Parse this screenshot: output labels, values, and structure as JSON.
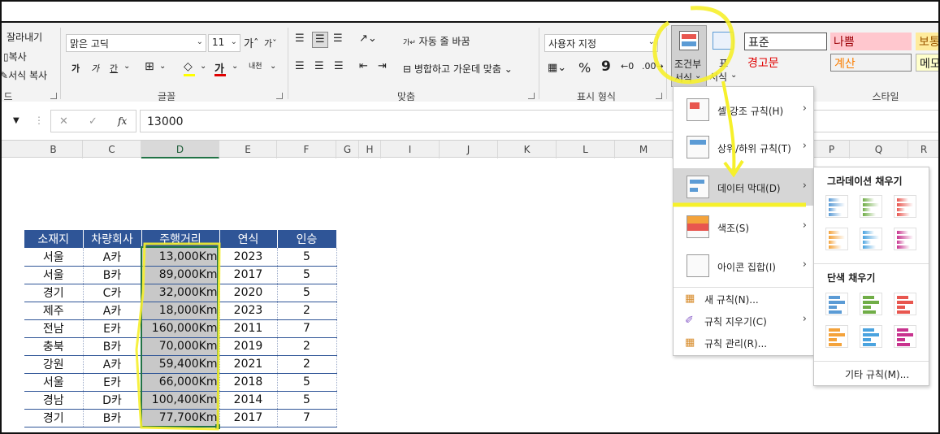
{
  "clipboard": {
    "cut": "잘라내기",
    "copy": "복사",
    "format_painter": "서식 복사",
    "label": "드"
  },
  "font": {
    "name": "맑은 고딕",
    "size": "11",
    "grow": "가",
    "shrink": "가",
    "bold": "가",
    "italic": "가",
    "underline": "간",
    "font_color_letter": "가",
    "phonetic": "내천",
    "label": "글꼴"
  },
  "alignment": {
    "wrap": "자동 줄 바꿈",
    "merge": "병합하고 가운데 맞춤",
    "label": "맞춤"
  },
  "number": {
    "format": "사용자 지정",
    "percent": "%",
    "comma": "9",
    "label": "표시 형식"
  },
  "styles": {
    "conditional_line1": "조건부",
    "conditional_line2": "서식",
    "table_line1": "표",
    "table_line2": "서식",
    "normal": "표준",
    "bad": "나쁨",
    "good": "보통",
    "warning": "경고문",
    "calc": "계산",
    "memo": "메모",
    "label": "스타일"
  },
  "formula": {
    "value": "13000",
    "fx": "fx",
    "cancel": "✕",
    "enter": "✓"
  },
  "columns": [
    "B",
    "C",
    "D",
    "E",
    "F",
    "G",
    "H",
    "I",
    "J",
    "K",
    "L",
    "M",
    "P",
    "Q",
    "R"
  ],
  "table": {
    "headers": [
      "소재지",
      "차량회사",
      "주행거리",
      "연식",
      "인승"
    ],
    "rows": [
      [
        "서울",
        "A카",
        "13,000Km",
        "2023",
        "5"
      ],
      [
        "서울",
        "B카",
        "89,000Km",
        "2017",
        "5"
      ],
      [
        "경기",
        "C카",
        "32,000Km",
        "2020",
        "5"
      ],
      [
        "제주",
        "A카",
        "18,000Km",
        "2023",
        "2"
      ],
      [
        "전남",
        "E카",
        "160,000Km",
        "2011",
        "7"
      ],
      [
        "충북",
        "B카",
        "70,000Km",
        "2019",
        "2"
      ],
      [
        "강원",
        "A카",
        "59,400Km",
        "2021",
        "2"
      ],
      [
        "서울",
        "E카",
        "66,000Km",
        "2018",
        "5"
      ],
      [
        "경남",
        "D카",
        "100,400Km",
        "2014",
        "5"
      ],
      [
        "경기",
        "B카",
        "77,700Km",
        "2017",
        "7"
      ]
    ]
  },
  "menu": {
    "highlight": "셀 강조 규칙(H)",
    "topbottom": "상위/하위 규칙(T)",
    "databar": "데이터 막대(D)",
    "colorscale": "색조(S)",
    "iconset": "아이콘 집합(I)",
    "newrule": "새 규칙(N)...",
    "clearrule": "규칙 지우기(C)",
    "managerule": "규칙 관리(R)..."
  },
  "submenu": {
    "gradient_title": "그라데이션 채우기",
    "solid_title": "단색 채우기",
    "more": "기타 규칙(M)...",
    "colors": [
      "#5b9bd5",
      "#70ad47",
      "#e8564f",
      "#f4a33b",
      "#4aa3df",
      "#c8338e"
    ]
  }
}
